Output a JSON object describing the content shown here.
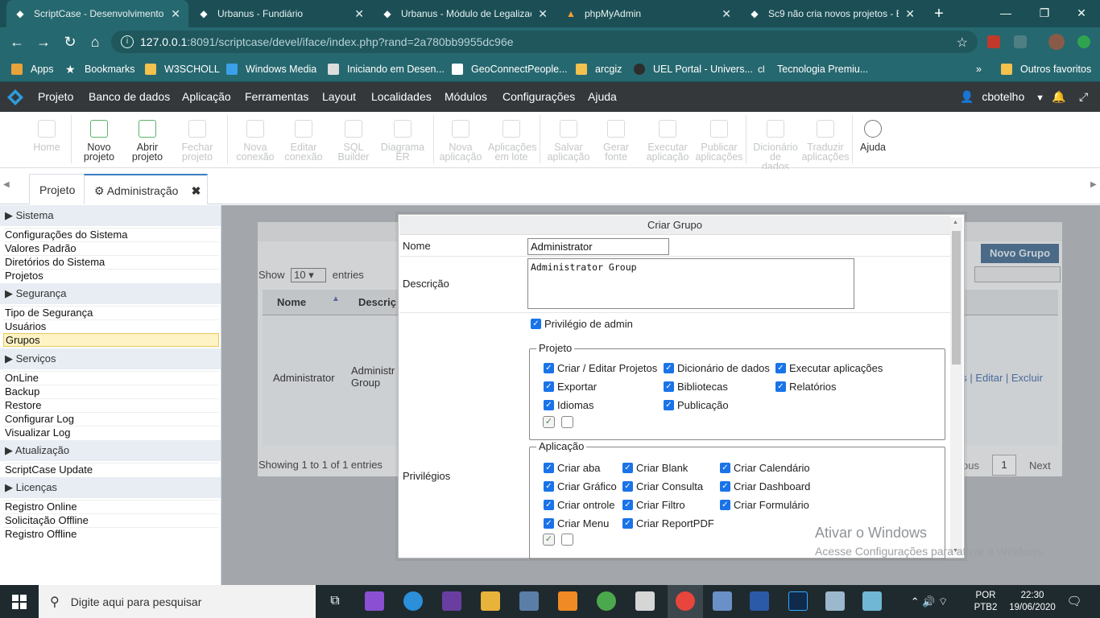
{
  "browser": {
    "tabs": [
      {
        "title": "ScriptCase - Desenvolvimento",
        "icon": "scriptcase-icon"
      },
      {
        "title": "Urbanus - Fundiário",
        "icon": "scriptcase-icon"
      },
      {
        "title": "Urbanus - Módulo de Legalizaç",
        "icon": "scriptcase-icon"
      },
      {
        "title": "phpMyAdmin",
        "icon": "phpmyadmin-icon"
      },
      {
        "title": "Sc9 não cria novos projetos - E",
        "icon": "scriptcase-icon"
      }
    ],
    "url_host": "127.0.0.1",
    "url_rest": ":8091/scriptcase/devel/iface/index.php?rand=2a780bb9955dc96e",
    "bookmarks": [
      "Apps",
      "Bookmarks",
      "W3SCHOLL",
      "Windows Media",
      "Iniciando em Desen...",
      "GeoConnectPeople...",
      "arcgiz",
      "UEL Portal - Univers...",
      "Tecnologia Premiu..."
    ],
    "other_bookmarks": "Outros favoritos",
    "more_bookmarks": "»"
  },
  "menu": {
    "items": [
      "Projeto",
      "Banco de dados",
      "Aplicação",
      "Ferramentas",
      "Layout",
      "Localidades",
      "Módulos",
      "Configurações",
      "Ajuda"
    ],
    "user": "cbotelho"
  },
  "ribbon": [
    {
      "line1": "Home",
      "line2": "",
      "enabled": false
    },
    {
      "line1": "Novo",
      "line2": "projeto",
      "enabled": true
    },
    {
      "line1": "Abrir",
      "line2": "projeto",
      "enabled": true
    },
    {
      "line1": "Fechar",
      "line2": "projeto",
      "enabled": false
    },
    {
      "line1": "Nova",
      "line2": "conexão",
      "enabled": false
    },
    {
      "line1": "Editar",
      "line2": "conexão",
      "enabled": false
    },
    {
      "line1": "SQL",
      "line2": "Builder",
      "enabled": false
    },
    {
      "line1": "Diagrama",
      "line2": "ER",
      "enabled": false
    },
    {
      "line1": "Nova",
      "line2": "aplicação",
      "enabled": false
    },
    {
      "line1": "Aplicações",
      "line2": "em lote",
      "enabled": false
    },
    {
      "line1": "Salvar",
      "line2": "aplicação",
      "enabled": false
    },
    {
      "line1": "Gerar",
      "line2": "fonte",
      "enabled": false
    },
    {
      "line1": "Executar",
      "line2": "aplicação",
      "enabled": false
    },
    {
      "line1": "Publicar",
      "line2": "aplicações",
      "enabled": false
    },
    {
      "line1": "Dicionário",
      "line2": "de",
      "line3": "dados",
      "enabled": false
    },
    {
      "line1": "Traduzir",
      "line2": "aplicações",
      "enabled": false
    },
    {
      "line1": "Ajuda",
      "line2": "",
      "enabled": true
    }
  ],
  "tabs": {
    "projeto": "Projeto",
    "admin": "Administração"
  },
  "sidebar": {
    "sections": [
      {
        "title": "Sistema",
        "items": [
          "Configurações do Sistema",
          "Valores Padrão",
          "Diretórios do Sistema",
          "Projetos"
        ]
      },
      {
        "title": "Segurança",
        "items": [
          "Tipo de Segurança",
          "Usuários",
          "Grupos"
        ]
      },
      {
        "title": "Serviços",
        "items": [
          "OnLine",
          "Backup",
          "Restore",
          "Configurar Log",
          "Visualizar Log"
        ]
      },
      {
        "title": "Atualização",
        "items": [
          "ScriptCase Update"
        ]
      },
      {
        "title": "Licenças",
        "items": [
          "Registro Online",
          "Solicitação Offline",
          "Registro Offline"
        ]
      }
    ],
    "selected": "Grupos"
  },
  "background_table": {
    "new_group": "Novo Grupo",
    "show": "Show",
    "page_size": "10",
    "entries": "entries",
    "col_name": "Nome",
    "col_desc": "Descriç",
    "row_name": "Administrator",
    "row_desc": "Administr\nGroup",
    "row_actions": "os | Editar | Excluir",
    "showing": "Showing 1 to 1 of 1 entries",
    "prev": "ous",
    "page": "1",
    "next": "Next"
  },
  "modal": {
    "title": "Criar Grupo",
    "name_label": "Nome",
    "name_value": "Administrator",
    "desc_label": "Descrição",
    "desc_value": "Administrator Group",
    "priv_label": "Privilégios",
    "admin_priv": "Privilégio de admin",
    "projeto_legend": "Projeto",
    "projeto_items": [
      "Criar / Editar Projetos",
      "Dicionário de dados",
      "Executar aplicações",
      "Exportar",
      "Bibliotecas",
      "Relatórios",
      "Idiomas",
      "Publicação"
    ],
    "aplicacao_legend": "Aplicação",
    "aplicacao_items": [
      "Criar aba",
      "Criar Blank",
      "Criar Calendário",
      "Criar Gráfico",
      "Criar Consulta",
      "Criar Dashboard",
      "Criar ontrole",
      "Criar Filtro",
      "Criar Formulário",
      "Criar Menu",
      "Criar ReportPDF"
    ]
  },
  "watermark": {
    "title": "Ativar o Windows",
    "sub": "Acesse Configurações para ativar o Windows."
  },
  "taskbar": {
    "search": "Digite aqui para pesquisar",
    "lang1": "POR",
    "lang2": "PTB2",
    "time": "22:30",
    "date": "19/06/2020"
  },
  "colors": {
    "chrome": "#26686f",
    "menu": "#34383b",
    "accent": "#1a73e8",
    "selected": "#fdf3c4"
  }
}
